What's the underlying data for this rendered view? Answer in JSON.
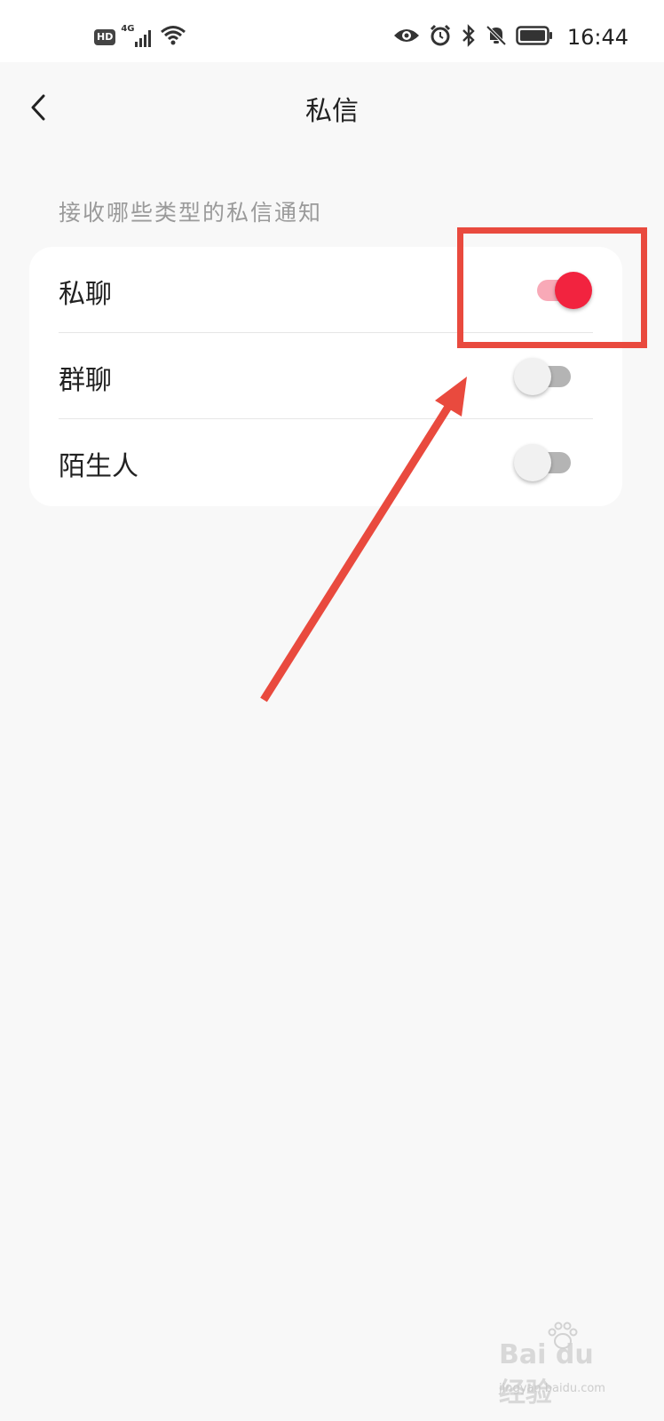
{
  "status_bar": {
    "badges": [
      "HD",
      "4G"
    ],
    "time": "16:44"
  },
  "header": {
    "title": "私信"
  },
  "section": {
    "caption": "接收哪些类型的私信通知"
  },
  "settings": [
    {
      "label": "私聊",
      "enabled": true
    },
    {
      "label": "群聊",
      "enabled": false
    },
    {
      "label": "陌生人",
      "enabled": false
    }
  ],
  "colors": {
    "accent": "#f2233f",
    "accent_track": "#f8a9b7",
    "annotation": "#e94a3e"
  },
  "watermark": {
    "brand": "Bai du 经验",
    "url": "jingyan.baidu.com"
  }
}
